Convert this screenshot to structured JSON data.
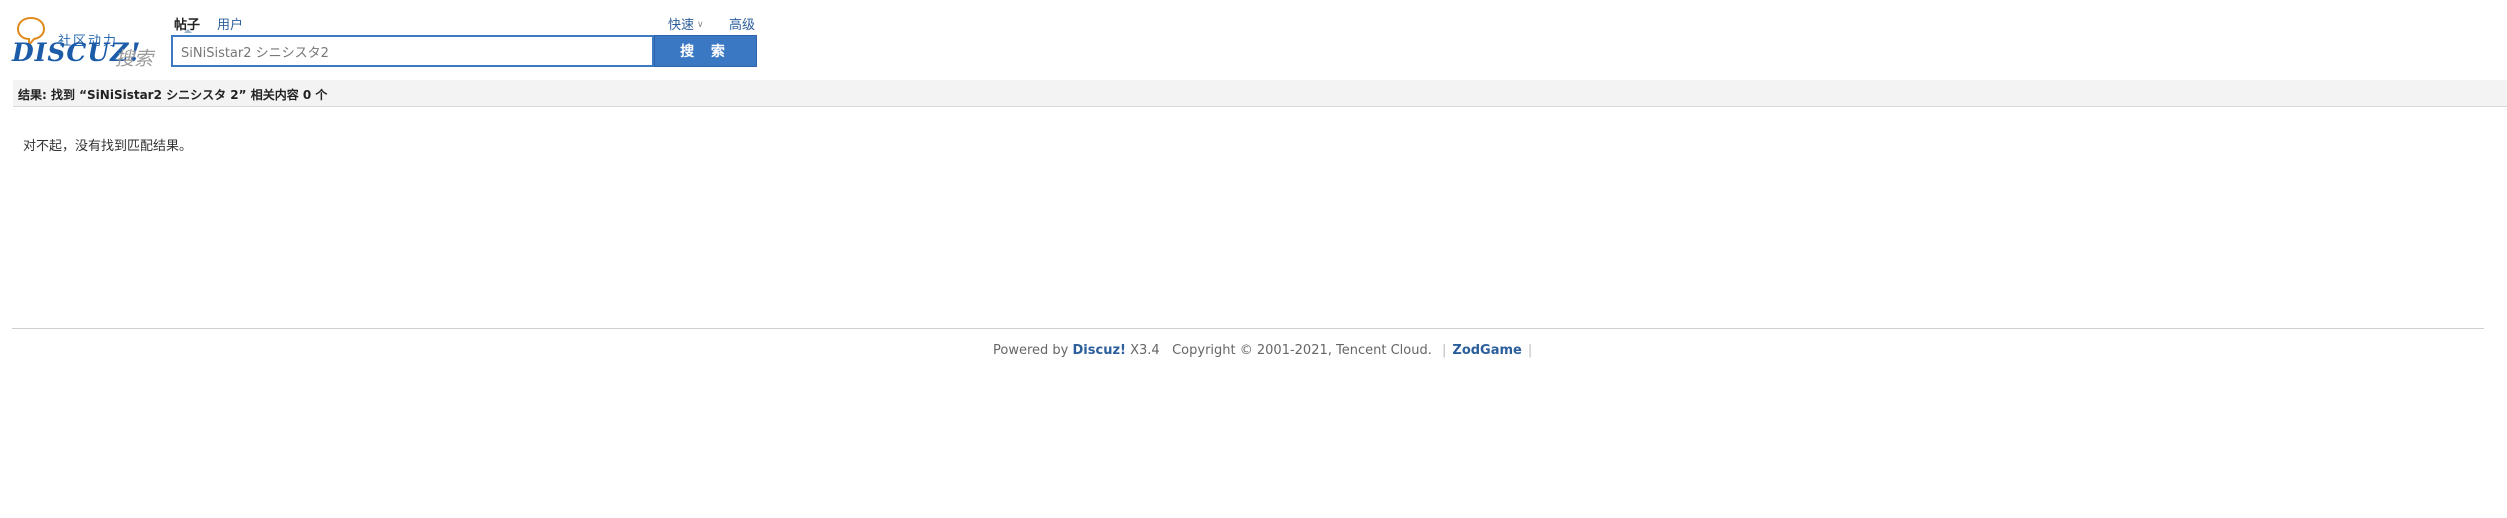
{
  "logo": {
    "tagline": "社区动力",
    "brand": "DISCUZ!",
    "suffix": "搜索"
  },
  "type_tabs": [
    {
      "label": "帖子",
      "active": true
    },
    {
      "label": "用户",
      "active": false
    }
  ],
  "links": {
    "quick": "快速",
    "advanced": "高级"
  },
  "search": {
    "value": "SiNiSistar2 シニシスタ2",
    "button": "搜 索"
  },
  "result": {
    "summary": "结果: 找到 “SiNiSistar2 シニシスタ 2” 相关内容 0 个"
  },
  "empty_message": "对不起，没有找到匹配结果。",
  "footer": {
    "powered_prefix": "Powered by",
    "brand": "Discuz!",
    "version": "X3.4",
    "copyright": "Copyright © 2001-2021, Tencent Cloud.",
    "site": "ZodGame"
  },
  "colors": {
    "accent": "#3a78c3",
    "link": "#2b5e9b",
    "logo": "#1c5ba8"
  }
}
